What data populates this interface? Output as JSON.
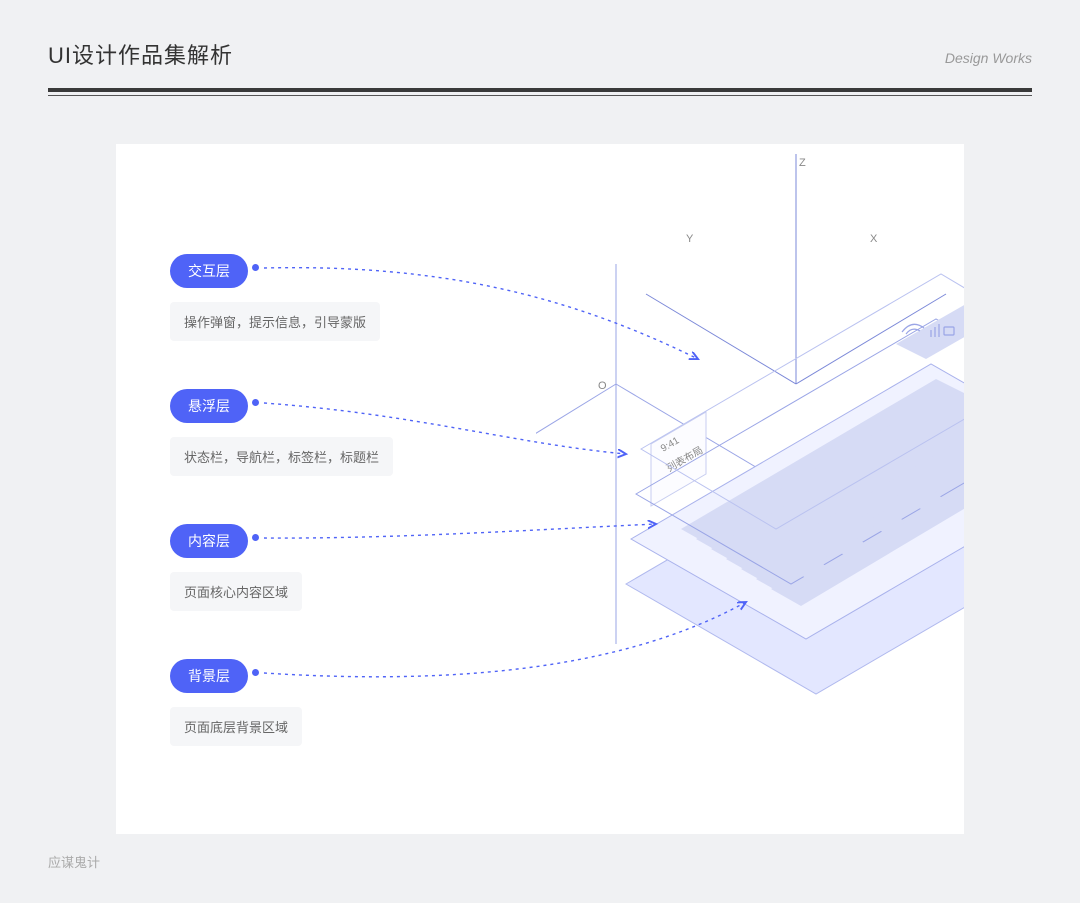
{
  "header": {
    "title": "UI设计作品集解析",
    "subtitle": "Design Works"
  },
  "layers": [
    {
      "name": "交互层",
      "desc": "操作弹窗，提示信息，引导蒙版"
    },
    {
      "name": "悬浮层",
      "desc": "状态栏，导航栏，标签栏，标题栏"
    },
    {
      "name": "内容层",
      "desc": "页面核心内容区域"
    },
    {
      "name": "背景层",
      "desc": "页面底层背景区域"
    }
  ],
  "axes": {
    "x": "X",
    "y": "Y",
    "z": "Z",
    "origin": "O"
  },
  "iso": {
    "time": "9:41",
    "layout_label": "列表布局"
  },
  "footer": "应谋鬼计"
}
